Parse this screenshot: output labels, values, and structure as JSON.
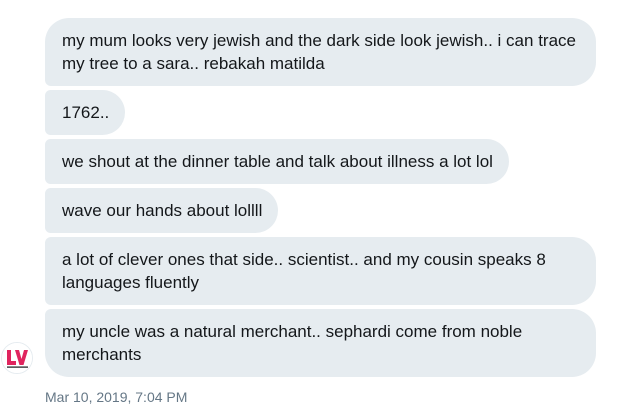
{
  "conversation": {
    "messages": [
      {
        "text": "my mum looks very jewish and the dark side look jewish.. i can trace my tree to a sara.. rebakah matilda"
      },
      {
        "text": "1762.."
      },
      {
        "text": "we shout at the dinner table and talk about illness a lot lol"
      },
      {
        "text": "wave our hands about lollll"
      },
      {
        "text": "a lot of clever ones that side.. scientist.. and my cousin speaks 8 languages fluently"
      },
      {
        "text": "my uncle was a natural merchant.. sephardi come from noble merchants"
      }
    ],
    "timestamp": "Mar 10, 2019, 7:04 PM",
    "avatar": {
      "letters": "LV"
    }
  },
  "colors": {
    "bubble": "#e6ecf0",
    "text": "#14171a",
    "timestamp": "#657786",
    "avatar_accent": "#e0245e"
  }
}
